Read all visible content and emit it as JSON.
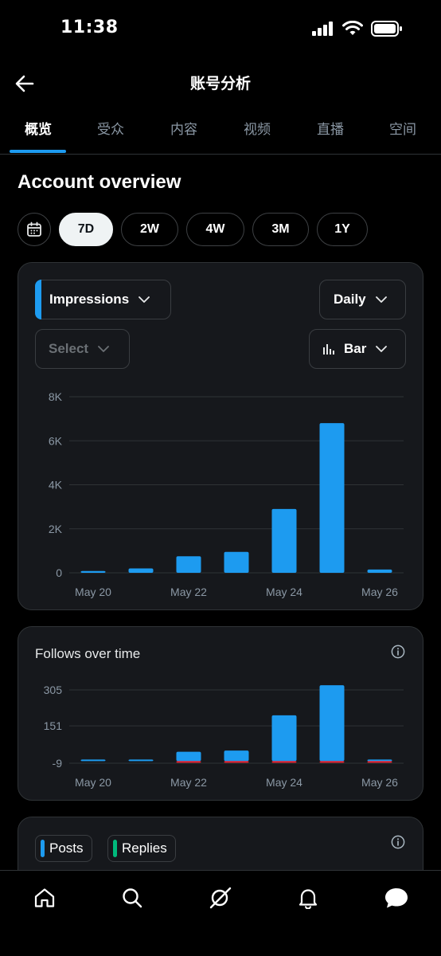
{
  "status": {
    "time": "11:38"
  },
  "header": {
    "title": "账号分析",
    "back_icon": "arrow-left-icon"
  },
  "tabs": [
    {
      "label": "概览",
      "active": true
    },
    {
      "label": "受众",
      "active": false
    },
    {
      "label": "内容",
      "active": false
    },
    {
      "label": "视频",
      "active": false
    },
    {
      "label": "直播",
      "active": false
    },
    {
      "label": "空间",
      "active": false
    }
  ],
  "overview": {
    "title": "Account overview",
    "ranges": [
      "7D",
      "2W",
      "4W",
      "3M",
      "1Y"
    ],
    "selected_range": "7D"
  },
  "main_chart": {
    "metric_label": "Impressions",
    "interval_label": "Daily",
    "compare_label": "Select",
    "type_label": "Bar",
    "colors": {
      "bar": "#1d9bf0",
      "grid": "#2f3336"
    }
  },
  "follows_chart": {
    "title": "Follows over time",
    "colors": {
      "positive": "#1d9bf0",
      "negative": "#f4212e"
    }
  },
  "posts_card": {
    "chips": [
      {
        "label": "Posts",
        "color": "#1d9bf0"
      },
      {
        "label": "Replies",
        "color": "#00ba7c"
      }
    ]
  },
  "chart_data": [
    {
      "type": "bar",
      "title": "",
      "categories": [
        "May 20",
        "May 21",
        "May 22",
        "May 23",
        "May 24",
        "May 25",
        "May 26"
      ],
      "series": [
        {
          "values": [
            80,
            200,
            750,
            950,
            2900,
            6800,
            150
          ]
        }
      ],
      "x_tick_labels": [
        "May 20",
        "May 22",
        "May 24",
        "May 26"
      ],
      "y_ticks": [
        0,
        2000,
        4000,
        6000,
        8000
      ],
      "y_tick_labels": [
        "0",
        "2K",
        "4K",
        "6K",
        "8K"
      ],
      "ylim": [
        0,
        8000
      ],
      "grid": true
    },
    {
      "type": "bar",
      "title": "Follows over time",
      "categories": [
        "May 20",
        "May 21",
        "May 22",
        "May 23",
        "May 24",
        "May 25",
        "May 26"
      ],
      "series": [
        {
          "values": [
            2,
            3,
            40,
            45,
            196,
            325,
            6
          ]
        },
        {
          "values": [
            0,
            0,
            -2,
            -4,
            -5,
            -5,
            -2
          ]
        }
      ],
      "x_tick_labels": [
        "May 20",
        "May 22",
        "May 24",
        "May 26"
      ],
      "y_ticks": [
        -9,
        151,
        305
      ],
      "y_tick_labels": [
        "-9",
        "151",
        "305"
      ],
      "ylim": [
        -9,
        305
      ],
      "grid": true
    }
  ]
}
